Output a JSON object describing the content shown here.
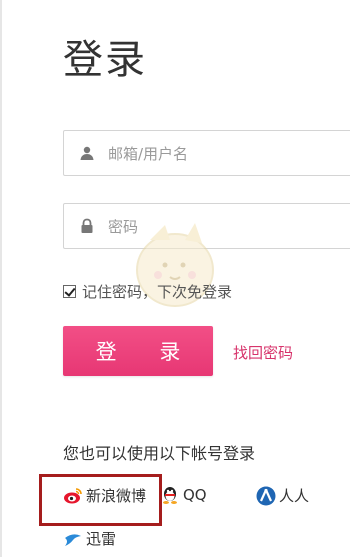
{
  "page": {
    "title": "登录"
  },
  "form": {
    "username_placeholder": "邮箱/用户名",
    "password_placeholder": "密码",
    "remember_label": "记住密码，下次免登录",
    "remember_checked": true,
    "login_button": "登 录",
    "forgot_link": "找回密码"
  },
  "alt_login": {
    "title": "您也可以使用以下帐号登录",
    "providers": [
      {
        "name": "新浪微博",
        "icon": "weibo-icon"
      },
      {
        "name": "QQ",
        "icon": "qq-icon"
      },
      {
        "name": "人人",
        "icon": "renren-icon"
      },
      {
        "name": "迅雷",
        "icon": "xunlei-icon"
      }
    ]
  },
  "colors": {
    "accent": "#e73774",
    "link": "#d7336b",
    "highlight": "#a51d1d"
  }
}
